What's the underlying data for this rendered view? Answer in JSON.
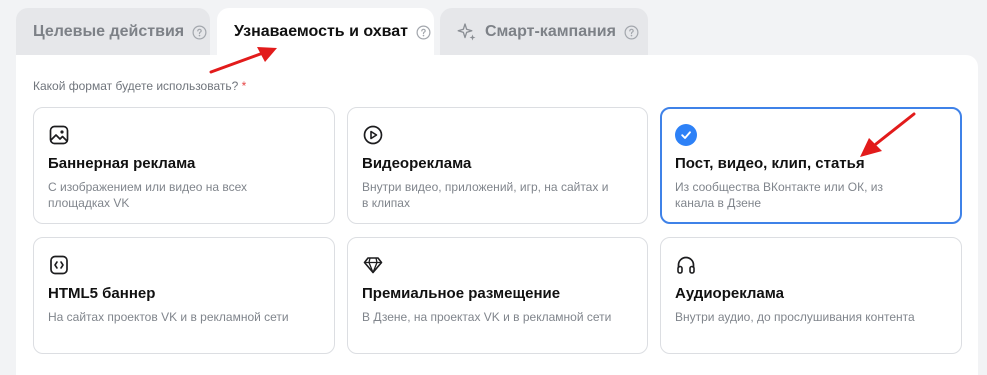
{
  "tabs": [
    {
      "label": "Целевые действия",
      "active": false
    },
    {
      "label": "Узнаваемость и охват",
      "active": true
    },
    {
      "label": "Смарт-кампания",
      "active": false
    }
  ],
  "form": {
    "question": "Какой формат будете использовать?",
    "required_mark": "*"
  },
  "formats": [
    {
      "title": "Баннерная реклама",
      "description": "С изображением или видео на всех площадках VK",
      "icon": "image-icon",
      "selected": false
    },
    {
      "title": "Видеореклама",
      "description": "Внутри видео, приложений, игр, на сайтах и в клипах",
      "icon": "play-circle-icon",
      "selected": false
    },
    {
      "title": "Пост, видео, клип, статья",
      "description": "Из сообщества ВКонтакте или ОК, из канала в Дзене",
      "icon": "check-circle-icon",
      "selected": true
    },
    {
      "title": "HTML5 баннер",
      "description": "На сайтах проектов VK и в рекламной сети",
      "icon": "html5-icon",
      "selected": false
    },
    {
      "title": "Премиальное размещение",
      "description": "В Дзене, на проектах VK и в рекламной сети",
      "icon": "diamond-icon",
      "selected": false
    },
    {
      "title": "Аудиореклама",
      "description": "Внутри аудио, до прослушивания контента",
      "icon": "headphones-icon",
      "selected": false
    }
  ],
  "colors": {
    "accent": "#2d81f7",
    "annotation_arrow": "#e21b1b"
  }
}
